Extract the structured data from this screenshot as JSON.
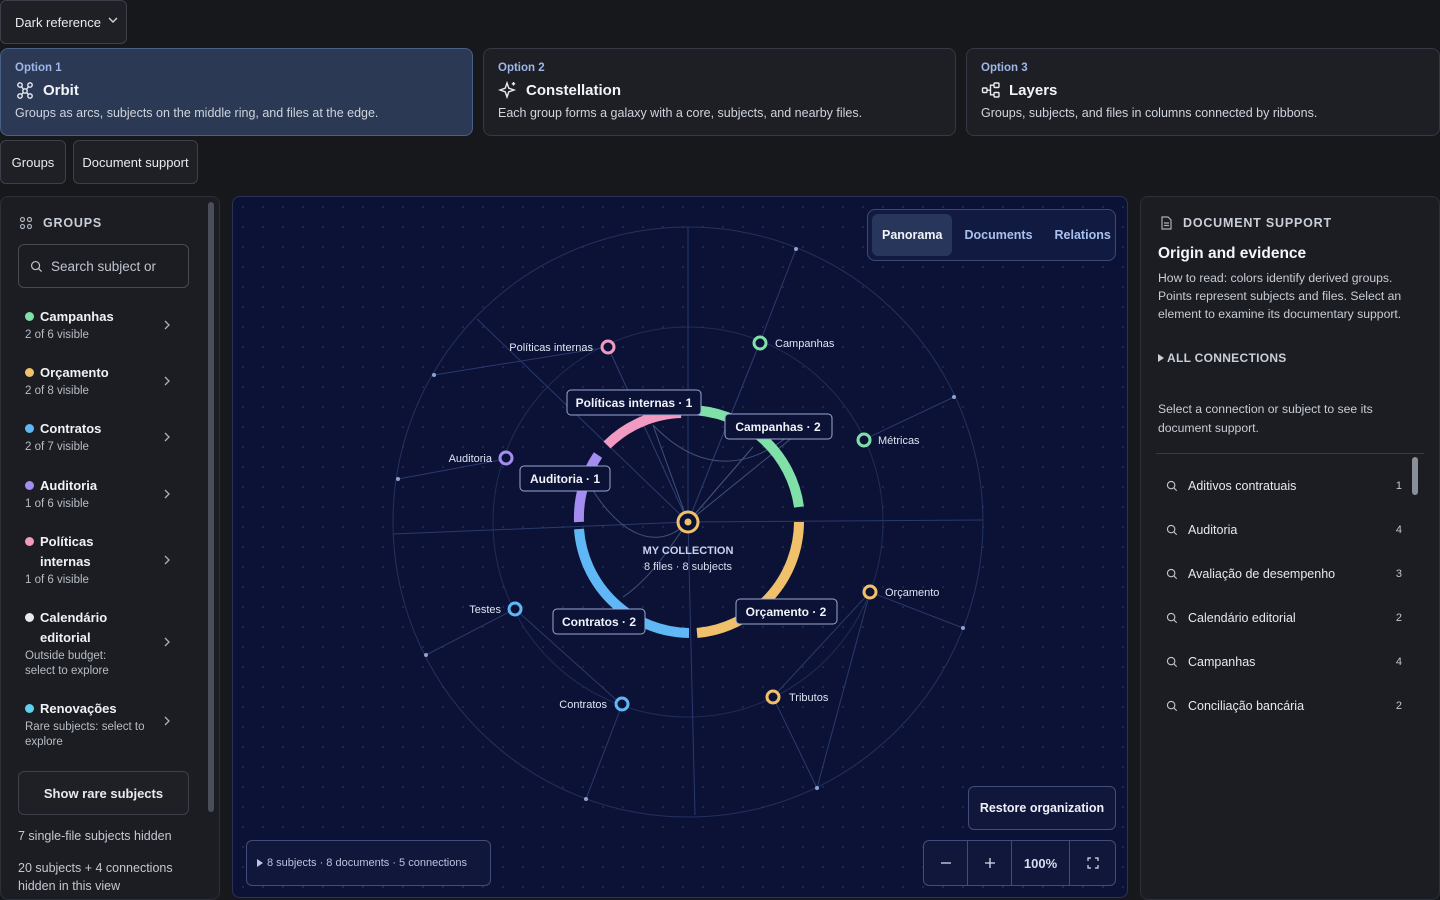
{
  "theme_select": {
    "value": "Dark reference"
  },
  "options": [
    {
      "kicker": "Option 1",
      "title": "Orbit",
      "icon": "orbit-icon",
      "description": "Groups as arcs, subjects on the middle ring, and files at the edge."
    },
    {
      "kicker": "Option 2",
      "title": "Constellation",
      "icon": "sparkle-icon",
      "description": "Each group forms a galaxy with a core, subjects, and nearby files."
    },
    {
      "kicker": "Option 3",
      "title": "Layers",
      "icon": "layers-icon",
      "description": "Groups, subjects, and files in columns connected by ribbons."
    }
  ],
  "panel_toggles": {
    "groups": "Groups",
    "document_support": "Document support"
  },
  "groups_panel": {
    "title": "GROUPS",
    "search_placeholder": "Search subject or",
    "items": [
      {
        "name": "Campanhas",
        "sub": "2 of 6 visible",
        "color": "#7fe0a8"
      },
      {
        "name": "Orçamento",
        "sub": "2 of 8 visible",
        "color": "#f0c16a"
      },
      {
        "name": "Contratos",
        "sub": "2 of 7 visible",
        "color": "#5fb8f5"
      },
      {
        "name": "Auditoria",
        "sub": "1 of 6 visible",
        "color": "#a48cf0"
      },
      {
        "name": "Políticas internas",
        "sub": "1 of 6 visible",
        "color": "#f39ac2"
      },
      {
        "name": "Calendário editorial",
        "sub": "Outside budget: select to explore",
        "color": "#e8eaf0"
      },
      {
        "name": "Renovações",
        "sub": "Rare subjects: select to explore",
        "color": "#5fd0f0"
      }
    ],
    "show_rare": "Show rare subjects",
    "hidden_single": "7 single-file subjects hidden",
    "hidden_summary": "20 subjects + 4 connections hidden in this view"
  },
  "canvas": {
    "view_tabs": [
      "Panorama",
      "Documents",
      "Relations"
    ],
    "active_tab": "Panorama",
    "center": {
      "title": "MY COLLECTION",
      "subtitle": "8 files · 8 subjects"
    },
    "arc_labels": {
      "politicas": "Políticas internas · 1",
      "campanhas": "Campanhas · 2",
      "auditoria": "Auditoria · 1",
      "orcamento": "Orçamento · 2",
      "contratos": "Contratos · 2"
    },
    "subjects": {
      "politicas": "Políticas internas",
      "campanhas": "Campanhas",
      "metricas": "Métricas",
      "auditoria": "Auditoria",
      "orcamento": "Orçamento",
      "testes": "Testes",
      "tributos": "Tributos",
      "contratos": "Contratos"
    },
    "restore": "Restore organization",
    "summary": "8 subjects · 8 documents · 5 connections",
    "zoom": "100%"
  },
  "support_panel": {
    "title": "DOCUMENT SUPPORT",
    "heading": "Origin and evidence",
    "description": "How to read: colors identify derived groups. Points represent subjects and files. Select an element to examine its documentary support.",
    "all_connections": "ALL CONNECTIONS",
    "hint": "Select a connection or subject to see its document support.",
    "connections": [
      {
        "label": "Aditivos contratuais",
        "count": "1"
      },
      {
        "label": "Auditoria",
        "count": "4"
      },
      {
        "label": "Avaliação de desempenho",
        "count": "3"
      },
      {
        "label": "Calendário editorial",
        "count": "2"
      },
      {
        "label": "Campanhas",
        "count": "4"
      },
      {
        "label": "Conciliação bancária",
        "count": "2"
      }
    ]
  }
}
